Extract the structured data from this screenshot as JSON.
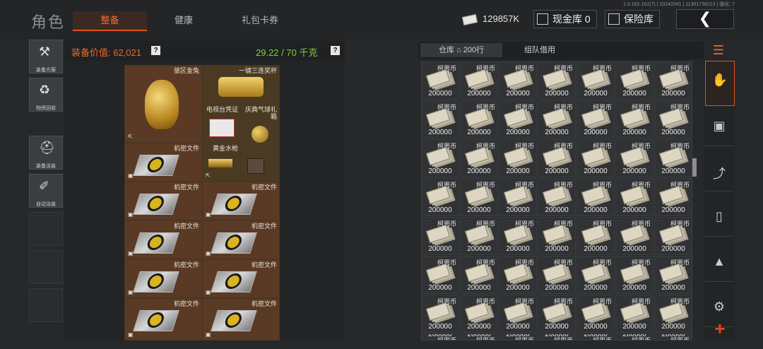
{
  "header": {
    "title": "角色",
    "tabs": [
      {
        "label": "整备",
        "active": true
      },
      {
        "label": "健康",
        "active": false
      },
      {
        "label": "礼包卡券",
        "active": false
      }
    ],
    "version": "1.0.162.162(7) | 10242041 | 11301739213 | 强化: 7",
    "money": "129857K",
    "cash_storage_label": "现金库 0",
    "safe_label": "保险库",
    "back_icon": "chevron-left-icon"
  },
  "tools": [
    {
      "label": "装备方案",
      "icon": "gear-set-icon"
    },
    {
      "label": "物资回收",
      "icon": "recycle-icon"
    },
    {
      "label": "装备涂装",
      "icon": "helmet-icon"
    },
    {
      "label": "自动涂装",
      "icon": "brush-icon"
    }
  ],
  "equipment": {
    "value_label": "装备价值: 62,021",
    "weight_label": "29.22 / 70 千克",
    "help": "?",
    "items": {
      "rabbit": "骇区金兔",
      "cup": "一键三连奖杯",
      "tv_cert": "电视台凭证",
      "balloon": "庆典气球礼箱",
      "faucet": "黄金水枪",
      "file": "机密文件"
    }
  },
  "storage": {
    "tab_warehouse": "仓库",
    "warehouse_count": "200行",
    "tab_team": "组队借用",
    "coin_name": "柯恩币",
    "coin_amount": "200000"
  },
  "colors": {
    "accent": "#e0521e",
    "value_orange": "#ea6a2a",
    "weight_green": "#7fd13b",
    "gold_cell": "#4a3a22",
    "brown_cell": "#5a3a24"
  }
}
